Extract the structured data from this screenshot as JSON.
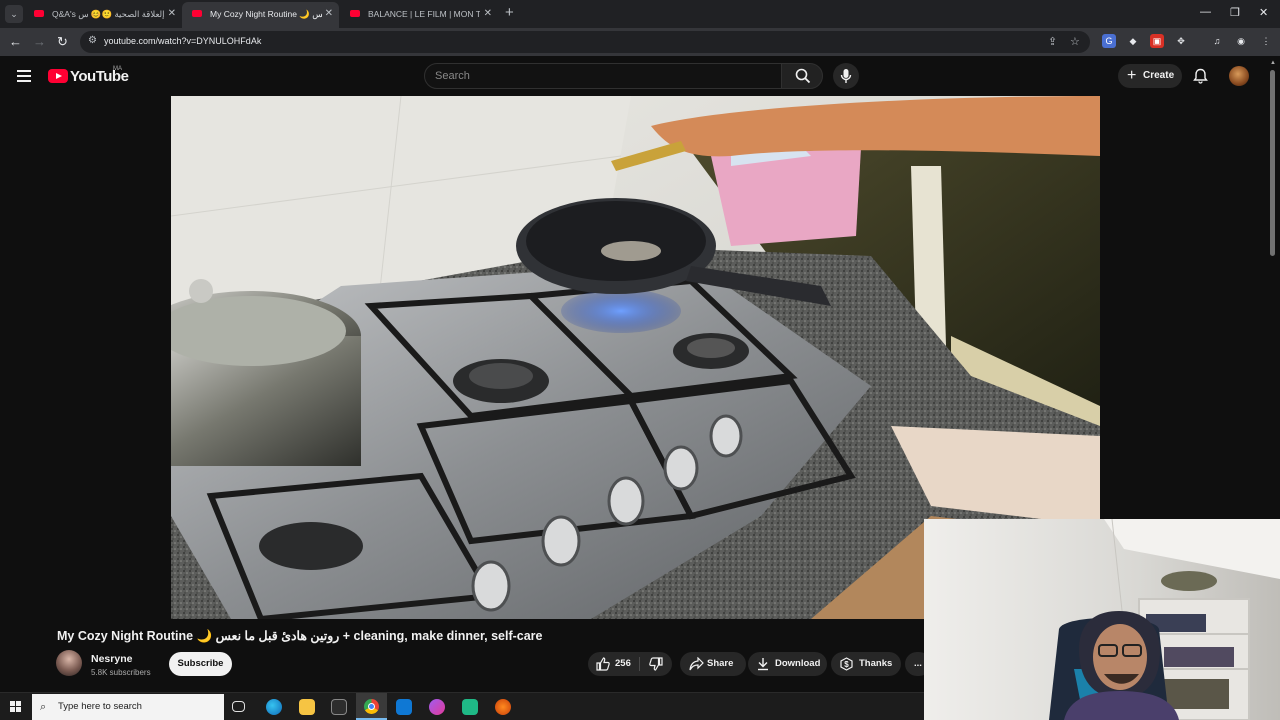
{
  "browser": {
    "tabs": [
      {
        "label": "Q&A's إلعلاقة الصحية 🙂😊 س",
        "active": false
      },
      {
        "label": "My Cozy Night Routine 🌙 نعس",
        "active": true
      },
      {
        "label": "BALANCE | LE FILM | MON TOU",
        "active": false
      }
    ],
    "url": "youtube.com/watch?v=DYNULOHFdAk"
  },
  "youtube": {
    "logo_text": "YouTube",
    "country_code": "MA",
    "search_placeholder": "Search",
    "create_label": "Create"
  },
  "video": {
    "title": "My Cozy Night Routine 🌙 روتين هادئ قبل ما نعس + cleaning, make dinner, self-care",
    "channel_name": "Nesryne",
    "subscribers": "5.8K subscribers",
    "subscribe_label": "Subscribe",
    "likes": "256",
    "share_label": "Share",
    "download_label": "Download",
    "thanks_label": "Thanks",
    "more_label": "..."
  },
  "taskbar": {
    "search_placeholder": "Type here to search"
  },
  "colors": {
    "youtube_red": "#ff0033",
    "page_bg": "#0f0f0f",
    "browser_frame": "#202124",
    "toolbar": "#35363a"
  }
}
